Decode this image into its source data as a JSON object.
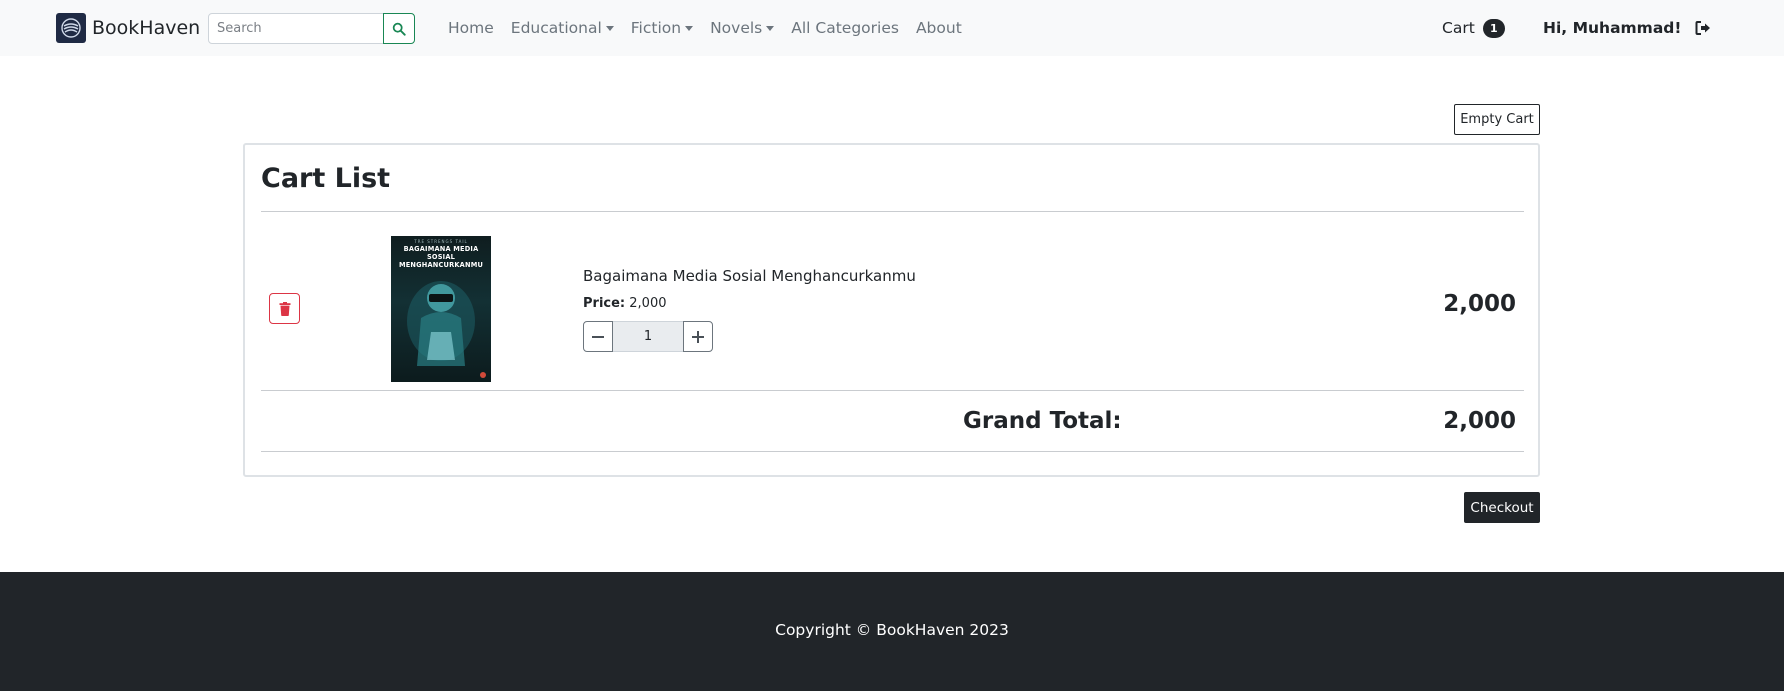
{
  "navbar": {
    "brand": "BookHaven",
    "search_placeholder": "Search",
    "links": [
      {
        "label": "Home",
        "dropdown": false
      },
      {
        "label": "Educational",
        "dropdown": true
      },
      {
        "label": "Fiction",
        "dropdown": true
      },
      {
        "label": "Novels",
        "dropdown": true
      },
      {
        "label": "All Categories",
        "dropdown": false
      },
      {
        "label": "About",
        "dropdown": false
      }
    ],
    "cart_label": "Cart",
    "cart_count": "1",
    "greeting": "Hi, Muhammad!",
    "icons": {
      "search": "search-icon",
      "logout": "logout-icon",
      "logo": "logo-icon"
    }
  },
  "main": {
    "empty_cart_label": "Empty Cart",
    "title": "Cart List",
    "items": [
      {
        "cover_top": "TRE STRENGS TAIL",
        "cover_title_1": "BAGAIMANA MEDIA SOSIAL",
        "cover_title_2": "MENGHANCURKANMU",
        "title": "Bagaimana Media Sosial Menghancurkanmu",
        "price_label": "Price:",
        "price": "2,000",
        "quantity": "1",
        "line_total": "2,000"
      }
    ],
    "grand_total_label": "Grand Total:",
    "grand_total": "2,000",
    "checkout_label": "Checkout"
  },
  "footer": {
    "copyright": "Copyright © BookHaven 2023"
  },
  "colors": {
    "navbar_bg": "#f8f9fa",
    "footer_bg": "#212529",
    "danger": "#dc3545",
    "success": "#198754",
    "dark": "#212529"
  }
}
